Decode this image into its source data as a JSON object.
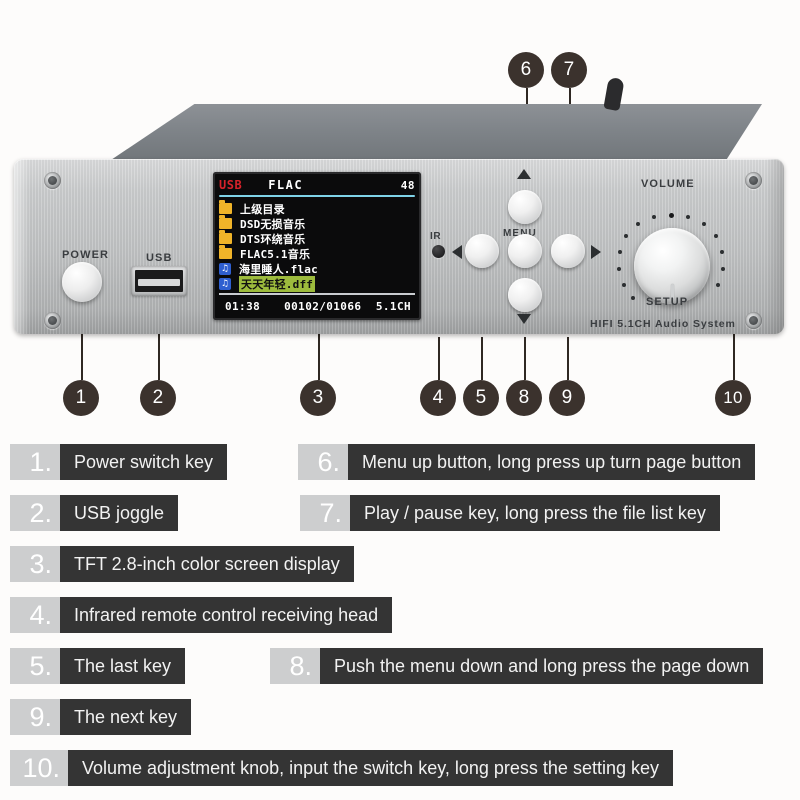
{
  "device": {
    "brand_text": "HIFI 5.1CH Audio System",
    "labels": {
      "power": "POWER",
      "usb": "USB",
      "ir": "IR",
      "menu": "MENU",
      "volume": "VOLUME",
      "setup": "SETUP"
    }
  },
  "screen": {
    "header": {
      "source": "USB",
      "format": "FLAC",
      "sample_rate": "48"
    },
    "files": [
      {
        "icon": "folder-icon",
        "name": "上级目录",
        "selected": false
      },
      {
        "icon": "folder-icon",
        "name": "DSD无损音乐",
        "selected": false
      },
      {
        "icon": "folder-icon",
        "name": "DTS环绕音乐",
        "selected": false
      },
      {
        "icon": "folder-icon",
        "name": "FLAC5.1音乐",
        "selected": false
      },
      {
        "icon": "music-note-icon",
        "name": "海里睡人.flac",
        "selected": false
      },
      {
        "icon": "music-note-icon",
        "name": "天天年轻.dff",
        "selected": true
      }
    ],
    "footer": {
      "elapsed": "01:38",
      "track_index": "00102/01066",
      "channels": "5.1CH"
    },
    "colors": {
      "source_red": "#d7222a",
      "rule_cyan": "#7fd3e8",
      "folder_yellow": "#f0b429",
      "note_blue": "#2f5fd0",
      "highlight_green": "#9dbb3d",
      "background": "#0b0b0c"
    }
  },
  "callouts": [
    {
      "number": "1"
    },
    {
      "number": "2"
    },
    {
      "number": "3"
    },
    {
      "number": "4"
    },
    {
      "number": "5"
    },
    {
      "number": "6"
    },
    {
      "number": "7"
    },
    {
      "number": "8"
    },
    {
      "number": "9"
    },
    {
      "number": "10"
    }
  ],
  "legend": [
    {
      "number": "1.",
      "text": "Power switch key"
    },
    {
      "number": "2.",
      "text": "USB joggle"
    },
    {
      "number": "3.",
      "text": "TFT 2.8-inch color screen display"
    },
    {
      "number": "4.",
      "text": "Infrared remote control receiving head"
    },
    {
      "number": "5.",
      "text": "The last key"
    },
    {
      "number": "6.",
      "text": "Menu up button, long press up turn page button"
    },
    {
      "number": "7.",
      "text": "Play / pause key, long press the file list key"
    },
    {
      "number": "8.",
      "text": "Push the menu down and long press the page down"
    },
    {
      "number": "9.",
      "text": "The next key"
    },
    {
      "number": "10.",
      "text": "Volume adjustment knob, input the switch key, long press the setting key"
    }
  ],
  "theme": {
    "badge_bg": "#3b322d",
    "legend_num_bg": "#cdcecf",
    "legend_text_bg": "#343434",
    "page_bg": "#fdfcfb"
  }
}
